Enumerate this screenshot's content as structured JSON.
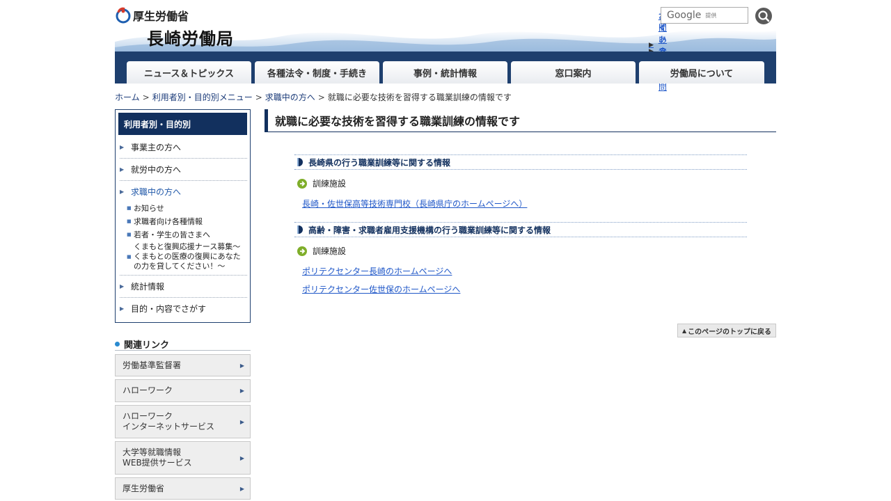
{
  "header": {
    "mhlw_name": "厚生労働省",
    "bureau_name": "長崎労働局",
    "util_links": [
      "サイトマップ",
      "お問い合わせ",
      "よくあるご質問"
    ],
    "search_brand": "Google",
    "search_provided": "提供"
  },
  "nav": {
    "tabs": [
      "ニュース＆トピックス",
      "各種法令・制度・手続き",
      "事例・統計情報",
      "窓口案内",
      "労働局について"
    ]
  },
  "breadcrumb": {
    "items": [
      "ホーム",
      "利用者別・目的別メニュー",
      "求職中の方へ"
    ],
    "current": "就職に必要な技術を習得する職業訓練の情報です",
    "separator": ">"
  },
  "sidebar": {
    "heading": "利用者別・目的別",
    "items": [
      "事業主の方へ",
      "就労中の方へ",
      "求職中の方へ",
      "統計情報",
      "目的・内容でさがす"
    ],
    "sub_items": [
      "お知らせ",
      "求職者向け各種情報",
      "若者・学生の皆さまへ",
      "くまもと復興応援ナース募集～くまもとの医療の復興にあなたの力を貸してください！～"
    ]
  },
  "related": {
    "title": "関連リンク",
    "links": [
      "労働基準監督署",
      "ハローワーク",
      "ハローワーク\nインターネットサービス",
      "大学等就職情報\nWEB提供サービス",
      "厚生労働省"
    ]
  },
  "main": {
    "title": "就職に必要な技術を習得する職業訓練の情報です",
    "sections": [
      {
        "heading": "長崎県の行う職業訓練等に関する情報",
        "subheading": "訓練施設",
        "links": [
          "長崎・佐世保高等技術専門校（長崎県庁のホームページへ）"
        ]
      },
      {
        "heading": "高齢・障害・求職者雇用支援機構の行う職業訓練等に関する情報",
        "subheading": "訓練施設",
        "links": [
          "ポリテクセンター長崎のホームページへ",
          "ポリテクセンター佐世保のホームページへ"
        ]
      }
    ],
    "page_top": "このページのトップに戻る"
  },
  "colors": {
    "navy": "#12305e",
    "link": "#1f57c8",
    "accent_blue": "#2a8bd0"
  }
}
